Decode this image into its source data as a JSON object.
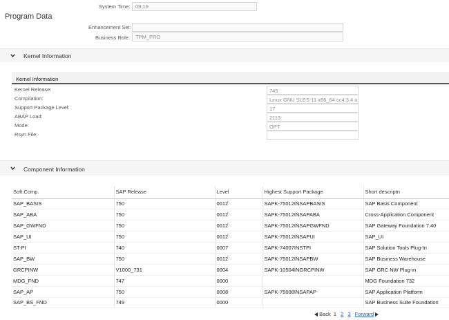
{
  "header": {
    "system_time_label": "System Time:",
    "system_time_value": "09:19",
    "page_title": "Program Data",
    "enhancement_set_label": "Enhancement Set:",
    "enhancement_set_value": "",
    "business_role_label": "Business Role:",
    "business_role_value": "TPM_PRO"
  },
  "kernel": {
    "section_title": "Kernel Information",
    "panel_title": "Kernel Information",
    "fields": [
      {
        "label": "Kernel Release:",
        "value": "745"
      },
      {
        "label": "Compilation:",
        "value": "Linux GNU SLES-11 x86_64 cc4.3.4 u..."
      },
      {
        "label": "Support Package Level:",
        "value": "17"
      },
      {
        "label": "ABAP Load:",
        "value": "2113"
      },
      {
        "label": "Mode:",
        "value": "OPT"
      },
      {
        "label": "Rsyn File:",
        "value": ""
      }
    ]
  },
  "components": {
    "section_title": "Component Information",
    "columns": [
      "Soft.Comp.",
      "SAP Release",
      "Level",
      "Highest Support Package",
      "Short descriptn"
    ],
    "rows": [
      [
        "SAP_BASIS",
        "750",
        "0012",
        "SAPK-75012INSAPBASIS",
        "SAP Basis Component"
      ],
      [
        "SAP_ABA",
        "750",
        "0012",
        "SAPK-75012INSAPABA",
        "Cross-Application Component"
      ],
      [
        "SAP_GWFND",
        "750",
        "0012",
        "SAPK-75012INSAPGWFND",
        "SAP Gateway Foundation 7.40"
      ],
      [
        "SAP_UI",
        "750",
        "0012",
        "SAPK-75012INSAPUI",
        "SAP_UI"
      ],
      [
        "ST-PI",
        "740",
        "0007",
        "SAPK-74007INSTPI",
        "SAP Solution Tools Plug-In"
      ],
      [
        "SAP_BW",
        "750",
        "0012",
        "SAPK-75012INSAPBW",
        "SAP Business Warehouse"
      ],
      [
        "GRCPINW",
        "V1000_731",
        "0004",
        "SAPK-10504INGRCPINW",
        "SAP GRC NW Plug-in"
      ],
      [
        "MDG_FND",
        "747",
        "0000",
        "",
        "MDG Foundation 732"
      ],
      [
        "SAP_AP",
        "750",
        "0008",
        "SAPK-75008INSAPAP",
        "SAP Application Platform"
      ],
      [
        "SAP_BS_FND",
        "749",
        "0000",
        "",
        "SAP Business Suite Foundation"
      ]
    ]
  },
  "pager": {
    "back_label": "Back",
    "pages": [
      "1",
      "2",
      "3"
    ],
    "forward_label": "Forward"
  },
  "colors": {
    "link": "#2a5db0",
    "section_band": "#f5f5f5",
    "field_border": "#d6d6d6"
  }
}
